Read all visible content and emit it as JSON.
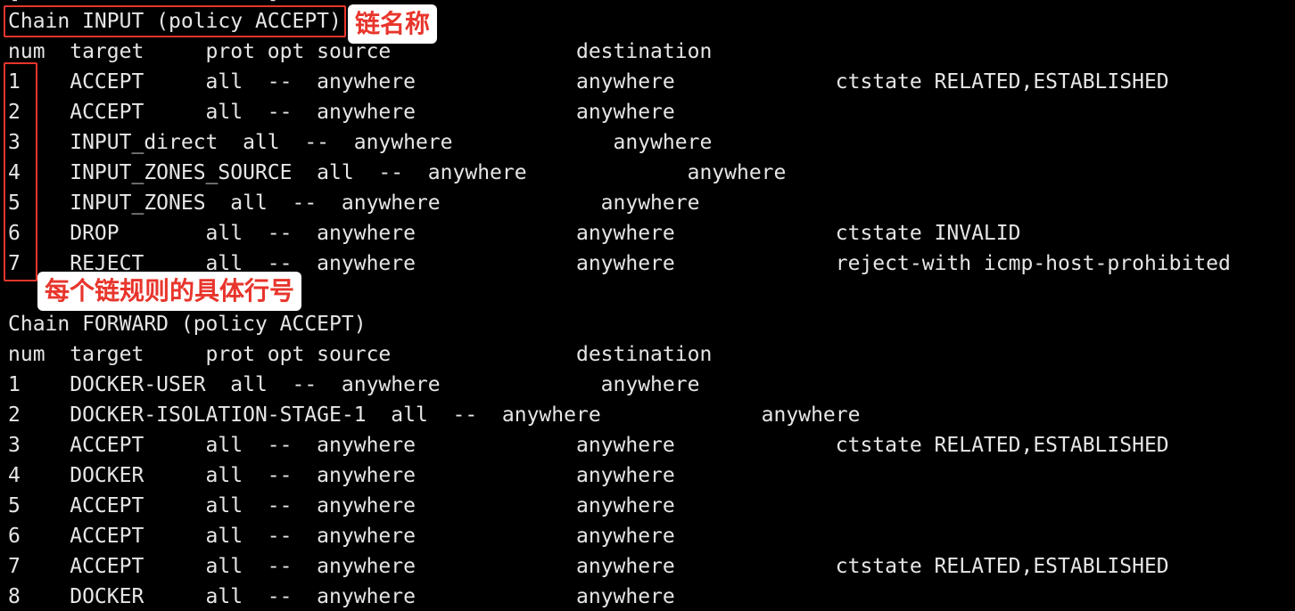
{
  "terminal": {
    "top_partial": "[                    ] ",
    "input_chain": {
      "header": "Chain INPUT (policy ACCEPT)",
      "columns": "num  target     prot opt source               destination",
      "rows": [
        "1    ACCEPT     all  --  anywhere             anywhere             ctstate RELATED,ESTABLISHED",
        "2    ACCEPT     all  --  anywhere             anywhere",
        "3    INPUT_direct  all  --  anywhere             anywhere",
        "4    INPUT_ZONES_SOURCE  all  --  anywhere             anywhere",
        "5    INPUT_ZONES  all  --  anywhere             anywhere",
        "6    DROP       all  --  anywhere             anywhere             ctstate INVALID",
        "7    REJECT     all  --  anywhere             anywhere             reject-with icmp-host-prohibited"
      ]
    },
    "forward_chain": {
      "header": "Chain FORWARD (policy ACCEPT)",
      "columns": "num  target     prot opt source               destination",
      "rows": [
        "1    DOCKER-USER  all  --  anywhere             anywhere",
        "2    DOCKER-ISOLATION-STAGE-1  all  --  anywhere             anywhere",
        "3    ACCEPT     all  --  anywhere             anywhere             ctstate RELATED,ESTABLISHED",
        "4    DOCKER     all  --  anywhere             anywhere",
        "5    ACCEPT     all  --  anywhere             anywhere",
        "6    ACCEPT     all  --  anywhere             anywhere",
        "7    ACCEPT     all  --  anywhere             anywhere             ctstate RELATED,ESTABLISHED",
        "8    DOCKER     all  --  anywhere             anywhere"
      ]
    }
  },
  "annotations": {
    "chain_name_label": "链名称",
    "row_number_label": "每个链规则的具体行号",
    "color": "#e8352c"
  }
}
